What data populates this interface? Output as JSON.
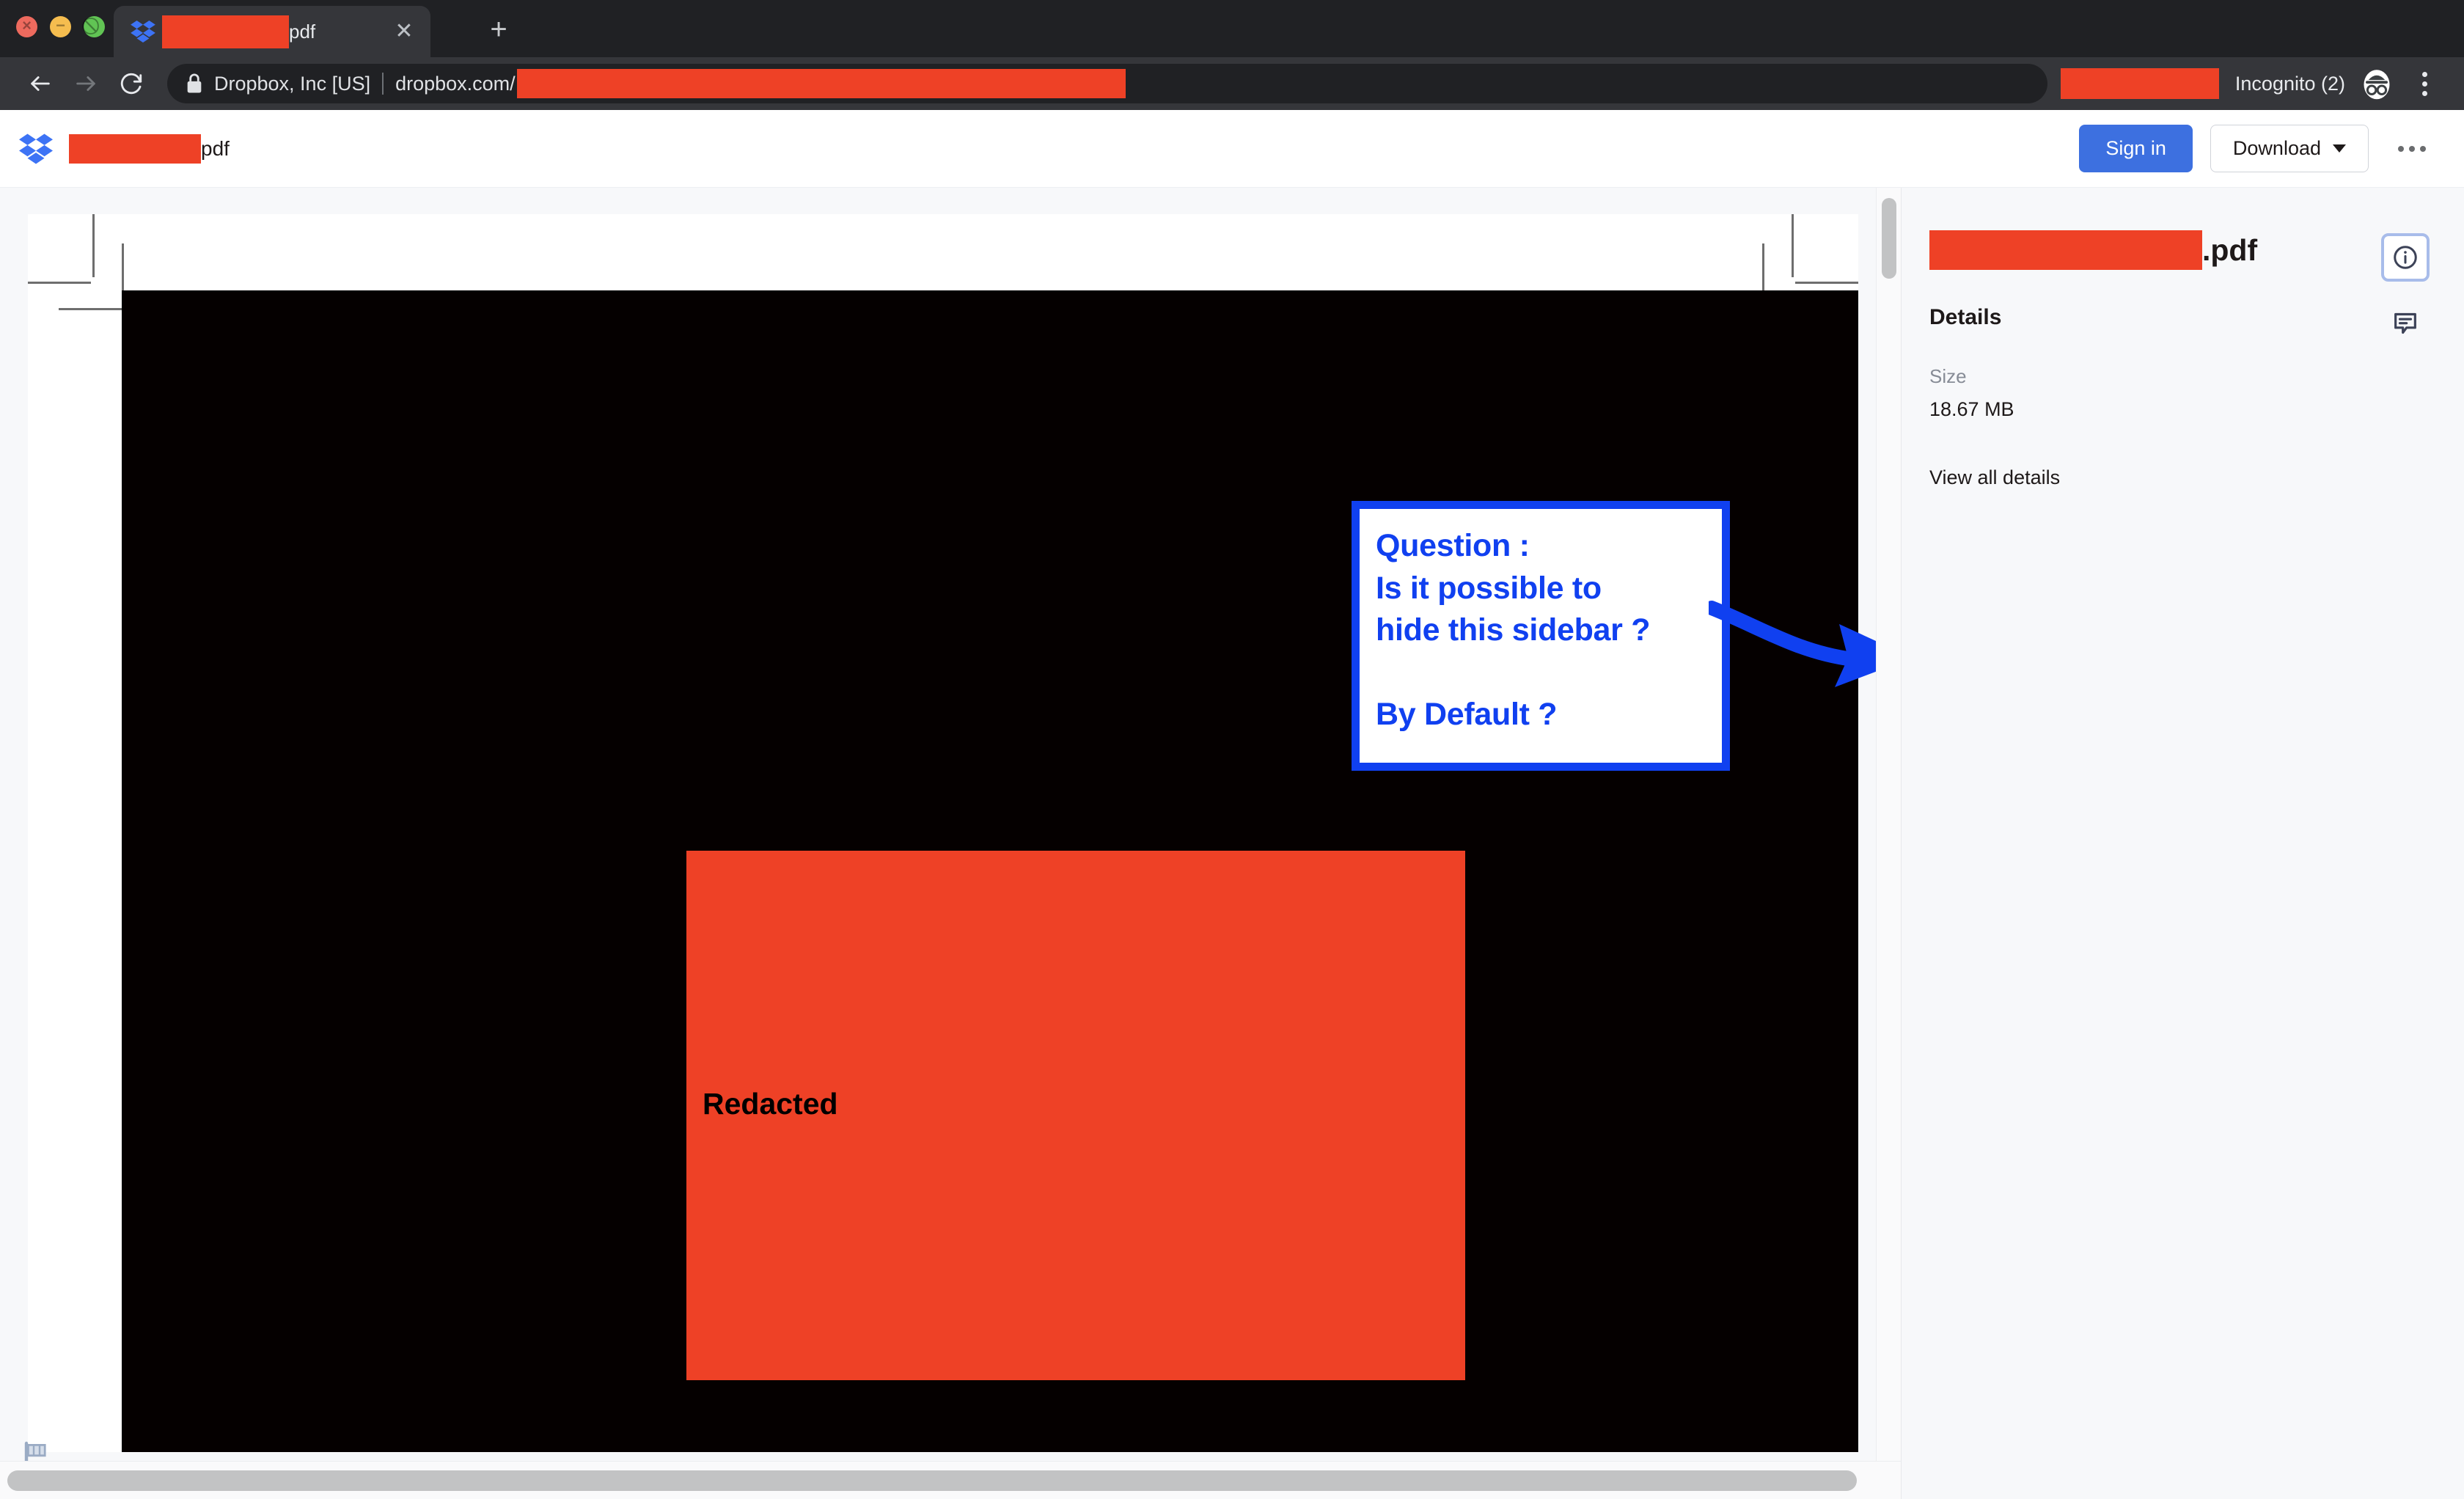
{
  "browser": {
    "window_controls": [
      "close",
      "minimize",
      "maximize"
    ],
    "tab": {
      "favicon": "dropbox-icon",
      "title_redacted": "",
      "title_suffix": "pdf",
      "close_icon": "close-icon"
    },
    "new_tab_icon": "plus-icon",
    "nav": {
      "back_icon": "back-arrow-icon",
      "forward_icon": "forward-arrow-icon",
      "reload_icon": "reload-icon"
    },
    "omnibox": {
      "lock_icon": "lock-icon",
      "security_label": "Dropbox, Inc [US]",
      "url": "dropbox.com/",
      "url_redacted": ""
    },
    "profile_redacted": "",
    "incognito_label": "Incognito (2)",
    "incognito_icon": "incognito-icon",
    "menu_icon": "kebab-menu-icon"
  },
  "app_header": {
    "logo": "dropbox-logo",
    "filename_redacted": "",
    "filename_suffix": "pdf",
    "sign_in_label": "Sign in",
    "download_label": "Download",
    "download_caret": "chevron-down-icon",
    "more_icon": "more-horizontal-icon"
  },
  "preview": {
    "page_type": "pdf-page",
    "page_background": "#050000",
    "redaction_color": "#EE4126",
    "redacted_label": "Redacted",
    "flag_icon": "flag-icon",
    "crop_marks": true,
    "annotation": {
      "text": "Question :\nIs it possible to\nhide this sidebar ?\n\nBy Default ?",
      "color": "#1040F0",
      "arrow_icon": "curved-arrow-right-icon"
    },
    "scrollbars": {
      "vertical": "vertical-scrollbar",
      "horizontal": "horizontal-scrollbar"
    }
  },
  "sidebar": {
    "filename_redacted": "",
    "filename_suffix": ".pdf",
    "details_heading": "Details",
    "fields": [
      {
        "label": "Size",
        "value": "18.67 MB"
      }
    ],
    "view_all_details": "View all details",
    "rail": [
      {
        "name": "info-icon",
        "active": true
      },
      {
        "name": "comment-icon",
        "active": false
      }
    ]
  },
  "colors": {
    "accent_blue": "#3D70E0",
    "annotation_blue": "#1040F0",
    "redaction_red": "#EE4126",
    "chrome_dark": "#202124",
    "chrome_toolbar": "#35363A"
  }
}
